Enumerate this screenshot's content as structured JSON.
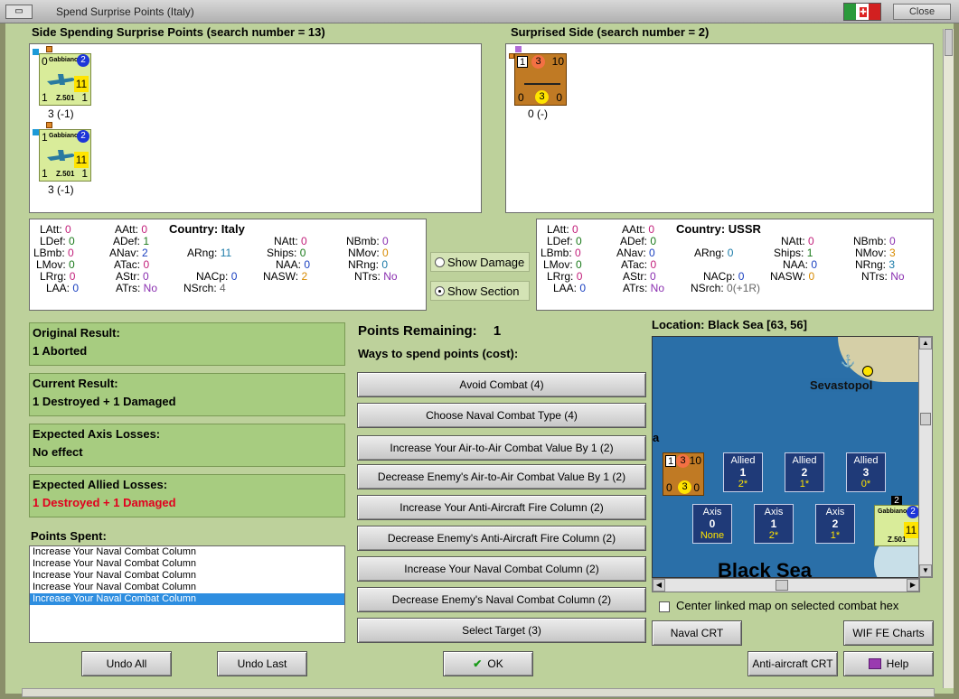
{
  "window": {
    "title": "Spend Surprise Points (Italy)",
    "close_label": "Close",
    "flag_colors": [
      "#2a9a3a",
      "#ffffff",
      "#d22020"
    ]
  },
  "left_panel": {
    "header": "Side Spending Surprise Points (search number = 13)",
    "units": [
      {
        "name": "Gabbiano",
        "top_left": "0",
        "badge": "2",
        "yellow": "11",
        "model": "Z.501",
        "bottom_left": "1",
        "bottom_right": "1",
        "caption": "3 (-1)"
      },
      {
        "name": "Gabbiano",
        "top_left": "1",
        "badge": "2",
        "yellow": "11",
        "model": "Z.501",
        "bottom_left": "1",
        "bottom_right": "1",
        "caption": "3 (-1)"
      }
    ]
  },
  "right_panel": {
    "header": "Surprised Side (search number = 2)",
    "unit": {
      "a": "1",
      "b": "3",
      "c": "10",
      "d": "0",
      "e": "3",
      "f": "0",
      "caption": "0 (-)"
    }
  },
  "stats_left": {
    "country_label": "Country:",
    "country": "Italy",
    "LAtt": "0",
    "AAtt": "0",
    "LDef": "0",
    "ADef": "1",
    "LBmb": "0",
    "ANav": "2",
    "ARng": "11",
    "NAtt": "0",
    "NBmb": "0",
    "Ships": "0",
    "NMov": "0",
    "LMov": "0",
    "ATac": "0",
    "NAA": "0",
    "NRng": "0",
    "LRrg": "0",
    "AStr": "0",
    "NACp": "0",
    "NASW": "2",
    "NTrs": "No",
    "LAA": "0",
    "ATrs": "No",
    "NSrch": "4"
  },
  "stats_right": {
    "country_label": "Country:",
    "country": "USSR",
    "LAtt": "0",
    "AAtt": "0",
    "LDef": "0",
    "ADef": "0",
    "LBmb": "0",
    "ANav": "0",
    "ARng": "0",
    "NAtt": "0",
    "NBmb": "0",
    "Ships": "1",
    "NMov": "3",
    "LMov": "0",
    "ATac": "0",
    "NAA": "0",
    "NRng": "3",
    "LRrg": "0",
    "AStr": "0",
    "NACp": "0",
    "NASW": "0",
    "NTrs": "No",
    "LAA": "0",
    "ATrs": "No",
    "NSrch": "0(+1R)"
  },
  "display_options": {
    "show_damage": "Show Damage",
    "show_section": "Show Section",
    "selected": "Show Section"
  },
  "results": {
    "original_label": "Original Result:",
    "original_value": "1 Aborted",
    "current_label": "Current Result:",
    "current_value": "1 Destroyed + 1 Damaged",
    "axis_label": "Expected Axis Losses:",
    "axis_value": "No effect",
    "allied_label": "Expected Allied Losses:",
    "allied_value": "1 Destroyed + 1 Damaged"
  },
  "points_spent": {
    "label": "Points Spent:",
    "items": [
      "Increase Your Naval Combat Column",
      "Increase Your Naval Combat Column",
      "Increase Your Naval Combat Column",
      "Increase Your Naval Combat Column",
      "Increase Your Naval Combat Column"
    ],
    "selected_index": 4
  },
  "spending": {
    "remaining_label": "Points Remaining:",
    "remaining_value": "1",
    "ways_label": "Ways to spend points (cost):",
    "options": [
      "Avoid Combat (4)",
      "Choose Naval Combat Type (4)",
      "Increase Your Air-to-Air Combat Value By 1 (2)",
      "Decrease Enemy's Air-to-Air Combat Value By 1 (2)",
      "Increase Your Anti-Aircraft Fire Column (2)",
      "Decrease Enemy's Anti-Aircraft Fire Column (2)",
      "Increase Your Naval Combat Column (2)",
      "Decrease Enemy's Naval Combat Column (2)",
      "Select Target (3)"
    ]
  },
  "map": {
    "location": "Location: Black Sea [63, 56]",
    "city": "Sevastopol",
    "sea_label": "Black Sea",
    "edge_letter": "a",
    "allied_boxes": [
      {
        "title": "Allied",
        "num": "1",
        "sub": "2*"
      },
      {
        "title": "Allied",
        "num": "2",
        "sub": "1*"
      },
      {
        "title": "Allied",
        "num": "3",
        "sub": "0*"
      }
    ],
    "axis_boxes": [
      {
        "title": "Axis",
        "num": "0",
        "sub": "None"
      },
      {
        "title": "Axis",
        "num": "1",
        "sub": "2*"
      },
      {
        "title": "Axis",
        "num": "2",
        "sub": "1*"
      }
    ],
    "ship_counter": {
      "a": "1",
      "b": "3",
      "c": "10",
      "d": "0",
      "e": "3",
      "f": "0"
    },
    "air_counter": {
      "name": "Gabbiano",
      "badge": "2",
      "yellow": "11",
      "model": "Z.501",
      "stack": "2"
    },
    "center_checkbox": "Center linked map on selected combat hex"
  },
  "buttons": {
    "undo_all": "Undo All",
    "undo_last": "Undo Last",
    "ok": "OK",
    "naval_crt": "Naval CRT",
    "wif_fe_charts": "WIF FE Charts",
    "aa_crt": "Anti-aircraft CRT",
    "help": "Help"
  }
}
